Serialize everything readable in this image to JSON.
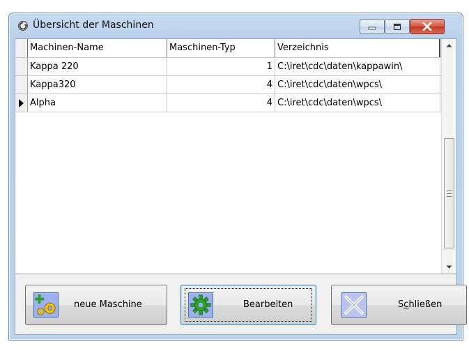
{
  "window": {
    "title": "Übersicht der Maschinen",
    "icon": "app-cycle-icon",
    "controls": [
      "minimize-icon",
      "maximize-icon",
      "close-icon"
    ]
  },
  "grid": {
    "columns": [
      "Machinen-Name",
      "Maschinen-Typ",
      "Verzeichnis"
    ],
    "rows": [
      {
        "name": "Kappa 220",
        "type": "1",
        "dir": "C:\\iret\\cdc\\daten\\kappawin\\"
      },
      {
        "name": "Kappa320",
        "type": "4",
        "dir": "C:\\iret\\cdc\\daten\\wpcs\\"
      },
      {
        "name": "Alpha",
        "type": "4",
        "dir": "C:\\iret\\cdc\\daten\\wpcs\\"
      }
    ],
    "current_row_index": 2
  },
  "buttons": {
    "new_label": "neue Maschine",
    "edit_label": "Bearbeiten",
    "close_label_pre": "S",
    "close_label_underline": "c",
    "close_label_post": "hließen"
  },
  "colors": {
    "accent_green": "#2f9e2f",
    "gear_yellow": "#e6c020",
    "close_red": "#c23a22"
  }
}
